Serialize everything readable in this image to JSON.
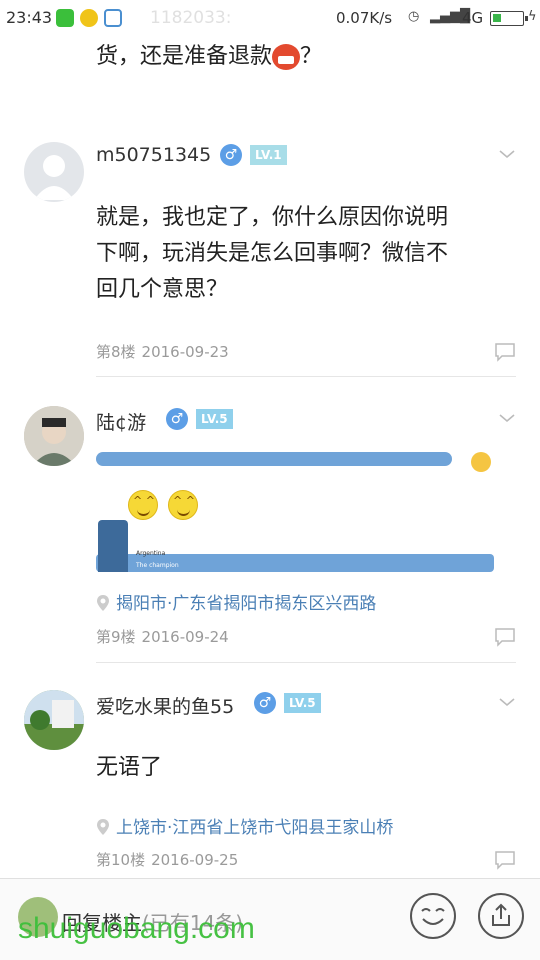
{
  "status_bar": {
    "time": "23:43",
    "net_speed": "0.07K/s",
    "network": "4G",
    "battery_level": 0.3
  },
  "header_ghost": "1182033: ",
  "continued_post": {
    "text": "货，还是准备退款",
    "tail": "？"
  },
  "posts": [
    {
      "username": "m50751345",
      "level": "LV.1",
      "body": [
        "就是，我也定了，你什么原因你说明",
        "下啊，玩消失是怎么回事啊？微信不",
        "回几个意思？"
      ],
      "floor": "第8楼",
      "date": "2016-09-23"
    },
    {
      "username": "陆¢游",
      "level": "LV.5",
      "location": "揭阳市·广东省揭阳市揭东区兴西路",
      "floor": "第9楼",
      "date": "2016-09-24",
      "sig_line1": "Argentina",
      "sig_line2": "The champion"
    },
    {
      "username": "爱吃水果的鱼55",
      "level": "LV.5",
      "body": [
        "无语了"
      ],
      "location": "上饶市·江西省上饶市弋阳县王家山桥",
      "floor": "第10楼",
      "date": "2016-09-25"
    }
  ],
  "bottom_bar": {
    "reply_label": "回复楼主",
    "reply_count": "(已有14条)"
  },
  "watermark": "shuiguobang.com",
  "colors": {
    "level_badge": "#a8dde8",
    "gender_badge": "#5c9ee6",
    "location_link": "#4a7fb5",
    "watermark": "#3dbf3a"
  }
}
